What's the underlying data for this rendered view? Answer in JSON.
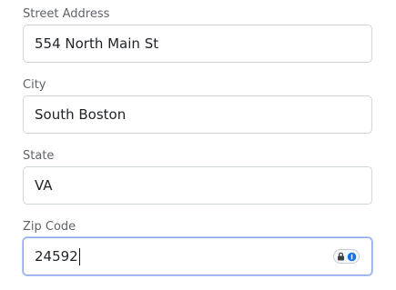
{
  "form": {
    "fields": [
      {
        "label": "Street Address",
        "value": "554 North Main St"
      },
      {
        "label": "City",
        "value": "South Boston"
      },
      {
        "label": "State",
        "value": "VA"
      },
      {
        "label": "Zip Code",
        "value": "24592"
      }
    ]
  },
  "colors": {
    "input_border": "#ced4da",
    "input_focus_border": "#86a7e8",
    "label_text": "#5f6368"
  },
  "icons": {
    "password_manager": "lock-and-info-icon"
  }
}
